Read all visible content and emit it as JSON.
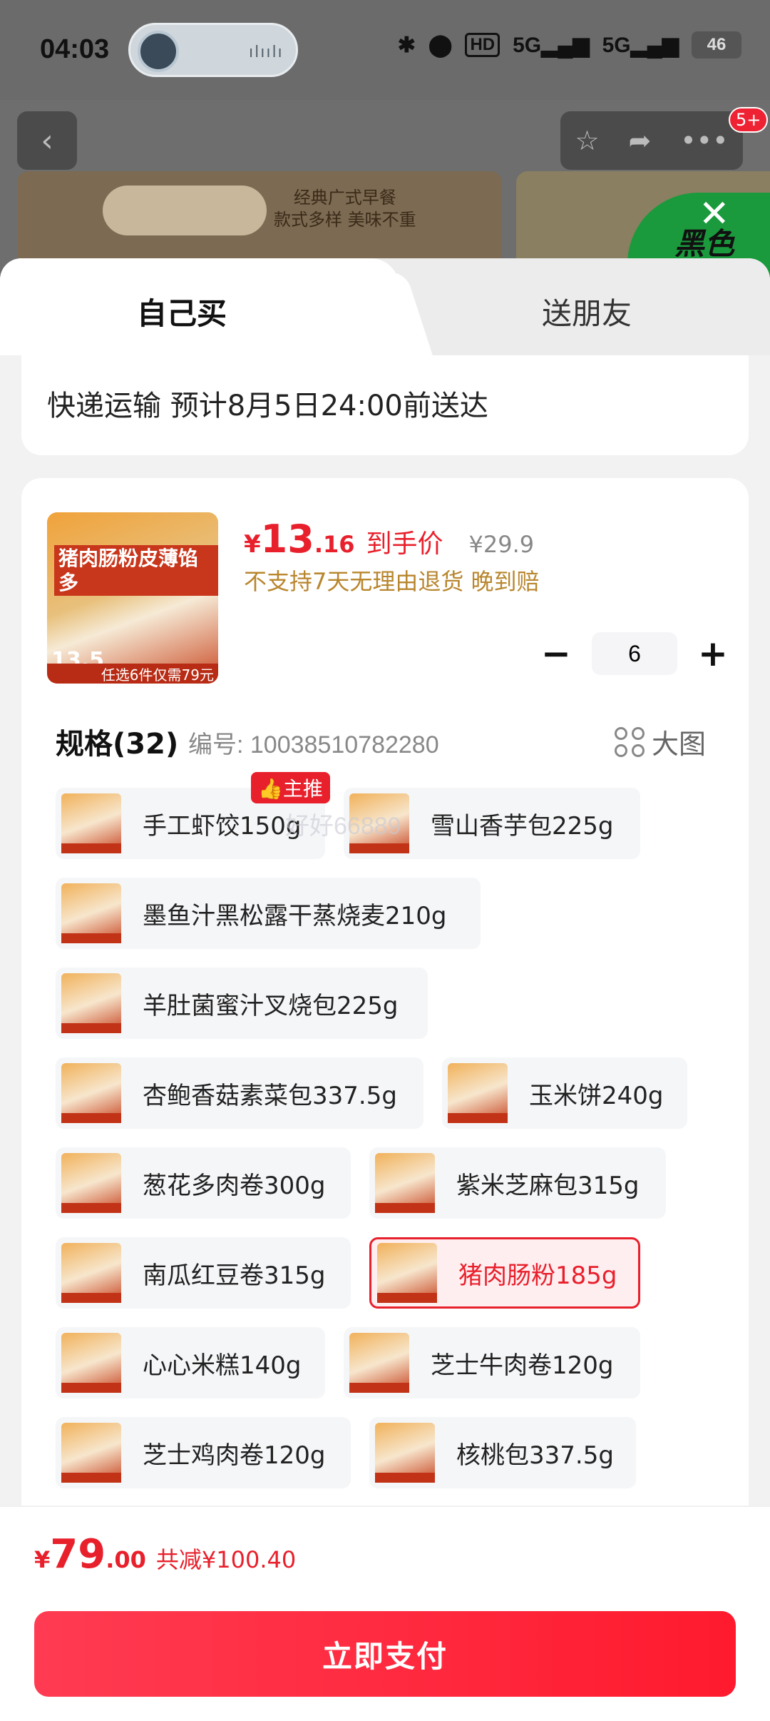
{
  "status": {
    "time": "04:03",
    "network1": "5G",
    "network2": "5G",
    "hd": "HD",
    "battery": "46"
  },
  "header": {
    "back_icon": "chevron-left-icon",
    "notif_badge": "5+",
    "banner_text_1": "经典广式早餐",
    "banner_text_2": "款式多样 美味不重",
    "side_text": "黑色"
  },
  "tabs": {
    "self": "自己买",
    "gift": "送朋友"
  },
  "address": {
    "delivery": "快递运输 预计8月5日24:00前送达"
  },
  "product": {
    "image_title": "猪肉肠粉皮薄馅多",
    "image_price": "13.5",
    "image_footer": "任选6件仅需79元",
    "price_symbol": "¥",
    "price_int": "13",
    "price_dec": ".16",
    "price_tag": "到手价",
    "orig_price": "¥29.9",
    "policy": "不支持7天无理由退货  晚到赔",
    "quantity": "6"
  },
  "spec": {
    "title": "规格(32)",
    "code": "编号: 10038510782280",
    "big_image": "大图",
    "rec_badge": "👍主推",
    "watermark": "好好66889"
  },
  "variants": [
    {
      "label": "手工虾饺150g"
    },
    {
      "label": "雪山香芋包225g"
    },
    {
      "label": "墨鱼汁黑松露干蒸烧麦210g"
    },
    {
      "label": "羊肚菌蜜汁叉烧包225g"
    },
    {
      "label": "杏鲍香菇素菜包337.5g"
    },
    {
      "label": "玉米饼240g"
    },
    {
      "label": "葱花多肉卷300g"
    },
    {
      "label": "紫米芝麻包315g"
    },
    {
      "label": "南瓜红豆卷315g"
    },
    {
      "label": "猪肉肠粉185g"
    },
    {
      "label": "心心米糕140g"
    },
    {
      "label": "芝士牛肉卷120g"
    },
    {
      "label": "芝士鸡肉卷120g"
    },
    {
      "label": "核桃包337.5g"
    }
  ],
  "bottom": {
    "sym": "¥",
    "int": "79",
    "dec": ".00",
    "save": "共减¥100.40",
    "pay": "立即支付"
  },
  "colors": {
    "accent": "#e8202c",
    "gold": "#b8862e"
  }
}
